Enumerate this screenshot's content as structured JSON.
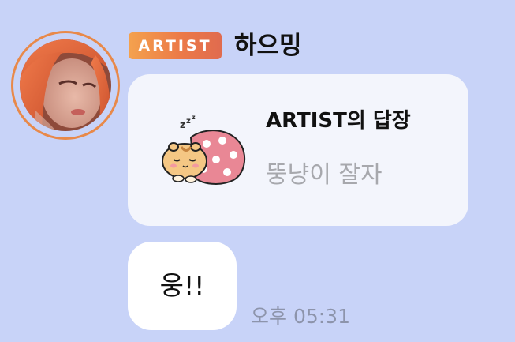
{
  "message": {
    "badge_label": "ARTIST",
    "artist_name": "하으밍",
    "reply": {
      "title": "ARTIST의 답장",
      "text": "뚱냥이 잘자",
      "sticker_icon": "sleeping-hamster-icon"
    },
    "bubble_text": "웅!!",
    "timestamp": "오후 05:31"
  },
  "colors": {
    "background": "#c8d3f8",
    "avatar_ring": "#e8894a",
    "badge_gradient_start": "#f4a24e",
    "badge_gradient_end": "#e06b4f",
    "card_background": "#f3f5fc",
    "bubble_background": "#ffffff",
    "timestamp_text": "#8d94ab",
    "reply_text": "#a7a8ad"
  }
}
